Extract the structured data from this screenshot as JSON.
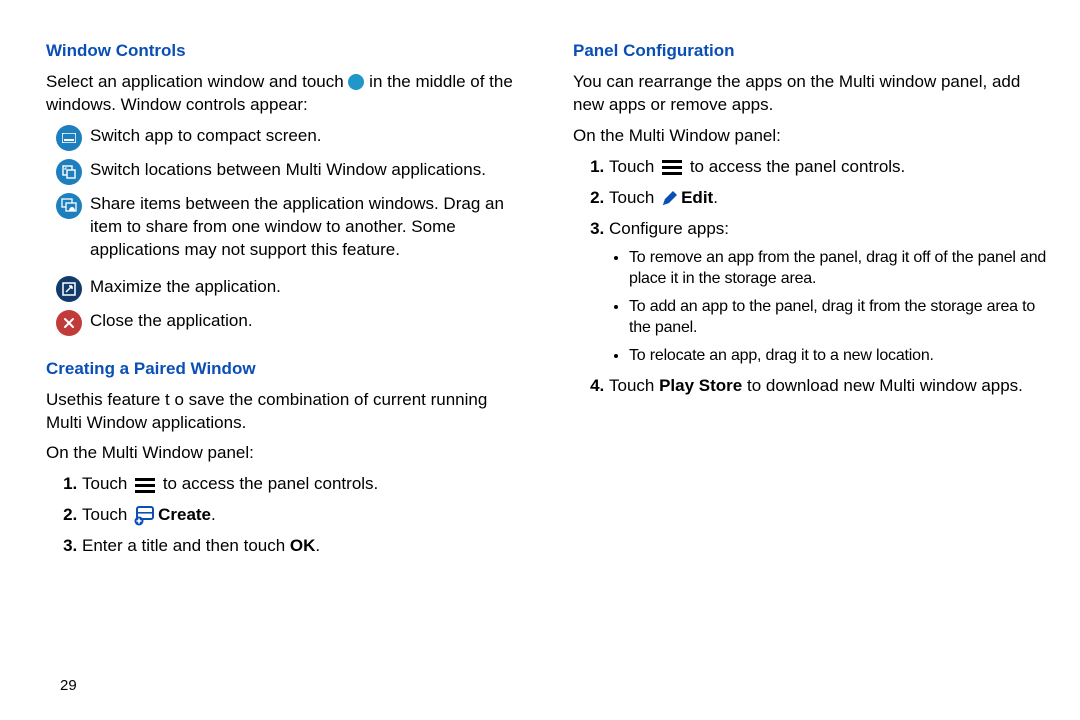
{
  "page_number": "29",
  "left": {
    "window_controls": {
      "heading": "Window Controls",
      "intro_a": "Select an application window and touch ",
      "intro_b": " in the middle of the windows. Window controls appear:",
      "items": [
        "Switch app to compact screen.",
        "Switch locations between Multi Window applications.",
        "Share items between the application windows. Drag an item to share from one window to another. Some applications may not support this feature.",
        "Maximize the application.",
        "Close the application."
      ]
    },
    "paired_window": {
      "heading": "Creating a Paired Window",
      "intro": "Usethis feature t o save the combination of current running Multi Window applications.",
      "subintro": "On the Multi Window panel:",
      "steps": {
        "s1a": "Touch ",
        "s1b": " to access the panel controls.",
        "s2a": "Touch ",
        "s2b": "Create",
        "s2c": ".",
        "s3a": "Enter a title and then touch ",
        "s3b": "OK",
        "s3c": "."
      }
    }
  },
  "right": {
    "panel_config": {
      "heading": "Panel Configuration",
      "intro": "You can rearrange the apps on the Multi window panel, add new apps or remove apps.",
      "subintro": "On the Multi Window panel:",
      "s1a": "Touch ",
      "s1b": " to access the panel controls.",
      "s2a": "Touch ",
      "s2b": "Edit",
      "s2c": ".",
      "s3": "Configure apps:",
      "bullets": [
        "To remove an app from the panel, drag it off of the panel and place it in the storage area.",
        "To add an app to the panel, drag it from the storage area to the panel.",
        "To relocate an app, drag it to a new location."
      ],
      "s4a": "Touch ",
      "s4b": "Play Store",
      "s4c": " to download new Multi window apps."
    }
  }
}
